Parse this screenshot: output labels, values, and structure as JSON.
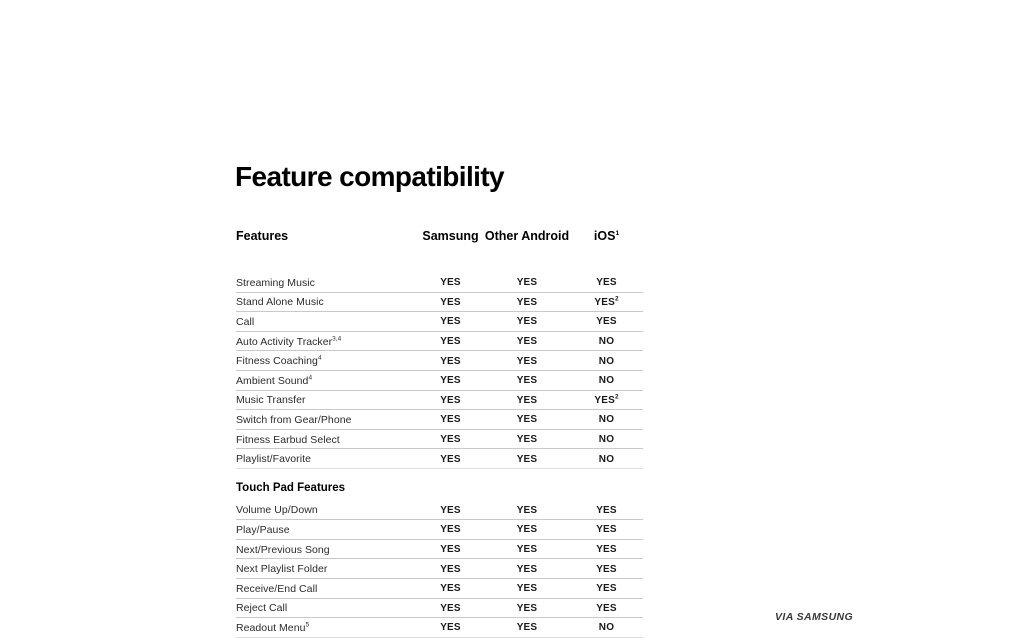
{
  "document": {
    "title": "Feature compatibility",
    "watermark": "VIA SAMSUNG"
  },
  "table": {
    "columns": {
      "feature": "Features",
      "samsung": "Samsung",
      "other_android": "Other Android",
      "ios": "iOS",
      "ios_superscript": "1"
    },
    "groups": [
      {
        "heading": null,
        "rows": [
          {
            "feature": "Streaming Music",
            "feature_sup": "",
            "samsung": "YES",
            "other_android": "YES",
            "ios": "YES",
            "ios_sup": ""
          },
          {
            "feature": "Stand Alone Music",
            "feature_sup": "",
            "samsung": "YES",
            "other_android": "YES",
            "ios": "YES",
            "ios_sup": "2"
          },
          {
            "feature": "Call",
            "feature_sup": "",
            "samsung": "YES",
            "other_android": "YES",
            "ios": "YES",
            "ios_sup": ""
          },
          {
            "feature": "Auto Activity Tracker",
            "feature_sup": "3,4",
            "samsung": "YES",
            "other_android": "YES",
            "ios": "NO",
            "ios_sup": ""
          },
          {
            "feature": "Fitness Coaching",
            "feature_sup": "4",
            "samsung": "YES",
            "other_android": "YES",
            "ios": "NO",
            "ios_sup": ""
          },
          {
            "feature": "Ambient Sound",
            "feature_sup": "4",
            "samsung": "YES",
            "other_android": "YES",
            "ios": "NO",
            "ios_sup": ""
          },
          {
            "feature": "Music Transfer",
            "feature_sup": "",
            "samsung": "YES",
            "other_android": "YES",
            "ios": "YES",
            "ios_sup": "2"
          },
          {
            "feature": "Switch from Gear/Phone",
            "feature_sup": "",
            "samsung": "YES",
            "other_android": "YES",
            "ios": "NO",
            "ios_sup": ""
          },
          {
            "feature": "Fitness Earbud Select",
            "feature_sup": "",
            "samsung": "YES",
            "other_android": "YES",
            "ios": "NO",
            "ios_sup": ""
          },
          {
            "feature": "Playlist/Favorite",
            "feature_sup": "",
            "samsung": "YES",
            "other_android": "YES",
            "ios": "NO",
            "ios_sup": ""
          }
        ]
      },
      {
        "heading": "Touch Pad Features",
        "rows": [
          {
            "feature": "Volume Up/Down",
            "feature_sup": "",
            "samsung": "YES",
            "other_android": "YES",
            "ios": "YES",
            "ios_sup": ""
          },
          {
            "feature": "Play/Pause",
            "feature_sup": "",
            "samsung": "YES",
            "other_android": "YES",
            "ios": "YES",
            "ios_sup": ""
          },
          {
            "feature": "Next/Previous Song",
            "feature_sup": "",
            "samsung": "YES",
            "other_android": "YES",
            "ios": "YES",
            "ios_sup": ""
          },
          {
            "feature": "Next Playlist Folder",
            "feature_sup": "",
            "samsung": "YES",
            "other_android": "YES",
            "ios": "YES",
            "ios_sup": ""
          },
          {
            "feature": "Receive/End Call",
            "feature_sup": "",
            "samsung": "YES",
            "other_android": "YES",
            "ios": "YES",
            "ios_sup": ""
          },
          {
            "feature": "Reject Call",
            "feature_sup": "",
            "samsung": "YES",
            "other_android": "YES",
            "ios": "YES",
            "ios_sup": ""
          },
          {
            "feature": "Readout Menu",
            "feature_sup": "5",
            "samsung": "YES",
            "other_android": "YES",
            "ios": "NO",
            "ios_sup": ""
          }
        ]
      }
    ]
  }
}
